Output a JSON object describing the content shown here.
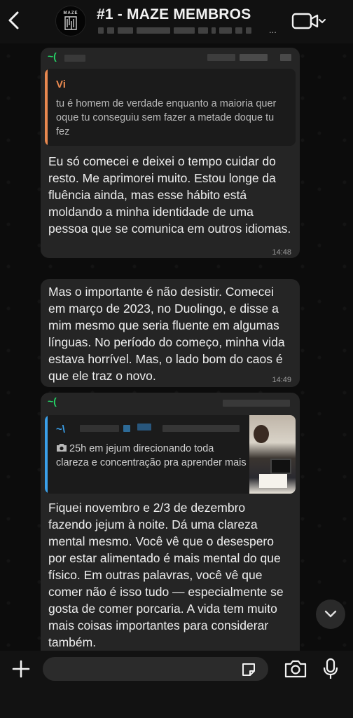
{
  "header": {
    "back_icon": "chevron-left-icon",
    "avatar_text": "MAZE",
    "title": "#1 - MAZE MEMBROS",
    "subtitle_suffix": "...",
    "video_icon": "video-camera-icon"
  },
  "messages": [
    {
      "sender": "~(",
      "quote": {
        "author": "Vi",
        "text": "tu é homem de verdade enquanto a maioria quer oque tu conseguiu sem fazer a metade doque tu fez",
        "color": "#e8884f"
      },
      "text": "Eu só comecei e deixei o tempo cuidar do resto. Me aprimorei muito. Estou longe da fluência ainda, mas esse hábito está moldando a minha identidade de uma pessoa que se comunica em outros idiomas.",
      "time": "14:48",
      "reaction": "❤"
    },
    {
      "text": "Mas o importante é não desistir. Comecei em março de 2023, no Duolingo, e disse a mim mesmo que seria fluente em algumas línguas. No período do começo, minha vida estava horrível. Mas, o lado bom do caos é que ele traz o novo.",
      "time": "14:49"
    },
    {
      "sender": "~(",
      "quote": {
        "author": "~\\",
        "text": "25h em jejum direcionando toda clareza e concentração pra aprender mais",
        "color": "#3aa0ea",
        "camera_icon": "camera-icon"
      },
      "text": "Fiquei novembro e 2/3 de dezembro fazendo jejum à noite. Dá uma clareza mental mesmo. Você vê que o desespero por estar alimentado é mais mental do que físico. Em outras palavras, você vê que comer não é isso tudo — especialmente se gosta de comer porcaria. A vida tem muito mais coisas importantes para considerar também."
    }
  ],
  "composer": {
    "placeholder": "",
    "plus_icon": "plus-icon",
    "sticker_icon": "sticker-icon",
    "camera_icon": "camera-icon",
    "mic_icon": "microphone-icon",
    "scroll_icon": "chevron-down-icon"
  }
}
